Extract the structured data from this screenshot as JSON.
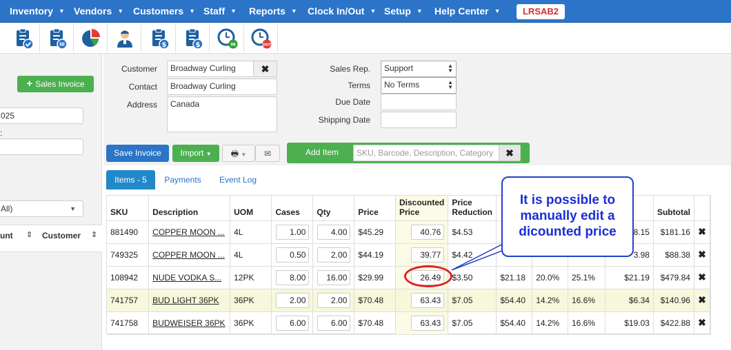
{
  "nav": {
    "items": [
      "Inventory",
      "Vendors",
      "Customers",
      "Staff",
      "Reports",
      "Clock In/Out",
      "Setup",
      "Help Center"
    ],
    "badge": "LRSAB2"
  },
  "toolbar": {
    "icons": [
      "clipboard-check-icon",
      "clipboard-list-icon",
      "pie-chart-icon",
      "user-icon",
      "clipboard-dollar-icon",
      "clipboard-dollar-alt-icon",
      "clock-in-icon",
      "clock-out-icon"
    ],
    "clock_in_label": "IN",
    "clock_out_label": "OUT"
  },
  "left": {
    "sales_invoice_label": "Sales Invoice",
    "date_value": "025",
    "field2_label": ":",
    "select_value": "All)",
    "col_count": "unt",
    "col_customer": "Customer"
  },
  "form": {
    "customer_label": "Customer",
    "customer_value": "Broadway Curling",
    "contact_label": "Contact",
    "contact_value": "Broadway Curling",
    "address_label": "Address",
    "address_value": "Canada",
    "salesrep_label": "Sales Rep.",
    "salesrep_value": "Support",
    "terms_label": "Terms",
    "terms_value": "No Terms",
    "duedate_label": "Due Date",
    "duedate_value": "",
    "shipping_label": "Shipping Date",
    "shipping_value": ""
  },
  "actions": {
    "save_label": "Save Invoice",
    "import_label": "Import",
    "add_item_label": "Add Item",
    "search_placeholder": "SKU, Barcode, Description, Category"
  },
  "tabs": [
    "Items - 5",
    "Payments",
    "Event Log"
  ],
  "table": {
    "headers": [
      "SKU",
      "Description",
      "UOM",
      "Cases",
      "Qty",
      "Price",
      "Discounted Price",
      "Price Reduction",
      "",
      "",
      "",
      "",
      "Subtotal"
    ],
    "rows": [
      {
        "sku": "881490",
        "desc": "COPPER MOON ...",
        "uom": "4L",
        "cases": "1.00",
        "qty": "4.00",
        "price": "$45.29",
        "disc": "40.76",
        "red": "$4.53",
        "c9": "",
        "c10": "",
        "c11": "",
        "c12": "8.15",
        "subtotal": "$181.16",
        "highlight": false
      },
      {
        "sku": "749325",
        "desc": "COPPER MOON ...",
        "uom": "4L",
        "cases": "0.50",
        "qty": "2.00",
        "price": "$44.19",
        "disc": "39.77",
        "red": "$4.42",
        "c9": "",
        "c10": "",
        "c11": "",
        "c12": "3.98",
        "subtotal": "$88.38",
        "highlight": false
      },
      {
        "sku": "108942",
        "desc": "NUDE VODKA S...",
        "uom": "12PK",
        "cases": "8.00",
        "qty": "16.00",
        "price": "$29.99",
        "disc": "26.49",
        "red": "$3.50",
        "c9": "$21.18",
        "c10": "20.0%",
        "c11": "25.1%",
        "c12": "$21.19",
        "subtotal": "$479.84",
        "highlight": false
      },
      {
        "sku": "741757",
        "desc": "BUD LIGHT 36PK",
        "uom": "36PK",
        "cases": "2.00",
        "qty": "2.00",
        "price": "$70.48",
        "disc": "63.43",
        "red": "$7.05",
        "c9": "$54.40",
        "c10": "14.2%",
        "c11": "16.6%",
        "c12": "$6.34",
        "subtotal": "$140.96",
        "highlight": true
      },
      {
        "sku": "741758",
        "desc": "BUDWEISER 36PK",
        "uom": "36PK",
        "cases": "6.00",
        "qty": "6.00",
        "price": "$70.48",
        "disc": "63.43",
        "red": "$7.05",
        "c9": "$54.40",
        "c10": "14.2%",
        "c11": "16.6%",
        "c12": "$19.03",
        "subtotal": "$422.88",
        "highlight": false
      }
    ]
  },
  "callout": {
    "line1": "It is possible to",
    "line2": "manually edit a",
    "line3": "dicounted price"
  },
  "colors": {
    "nav_bg": "#2b74c7",
    "green": "#4caf50",
    "blue_btn": "#2b74c7",
    "callout": "#1a2ed6",
    "circle": "#e02020"
  }
}
